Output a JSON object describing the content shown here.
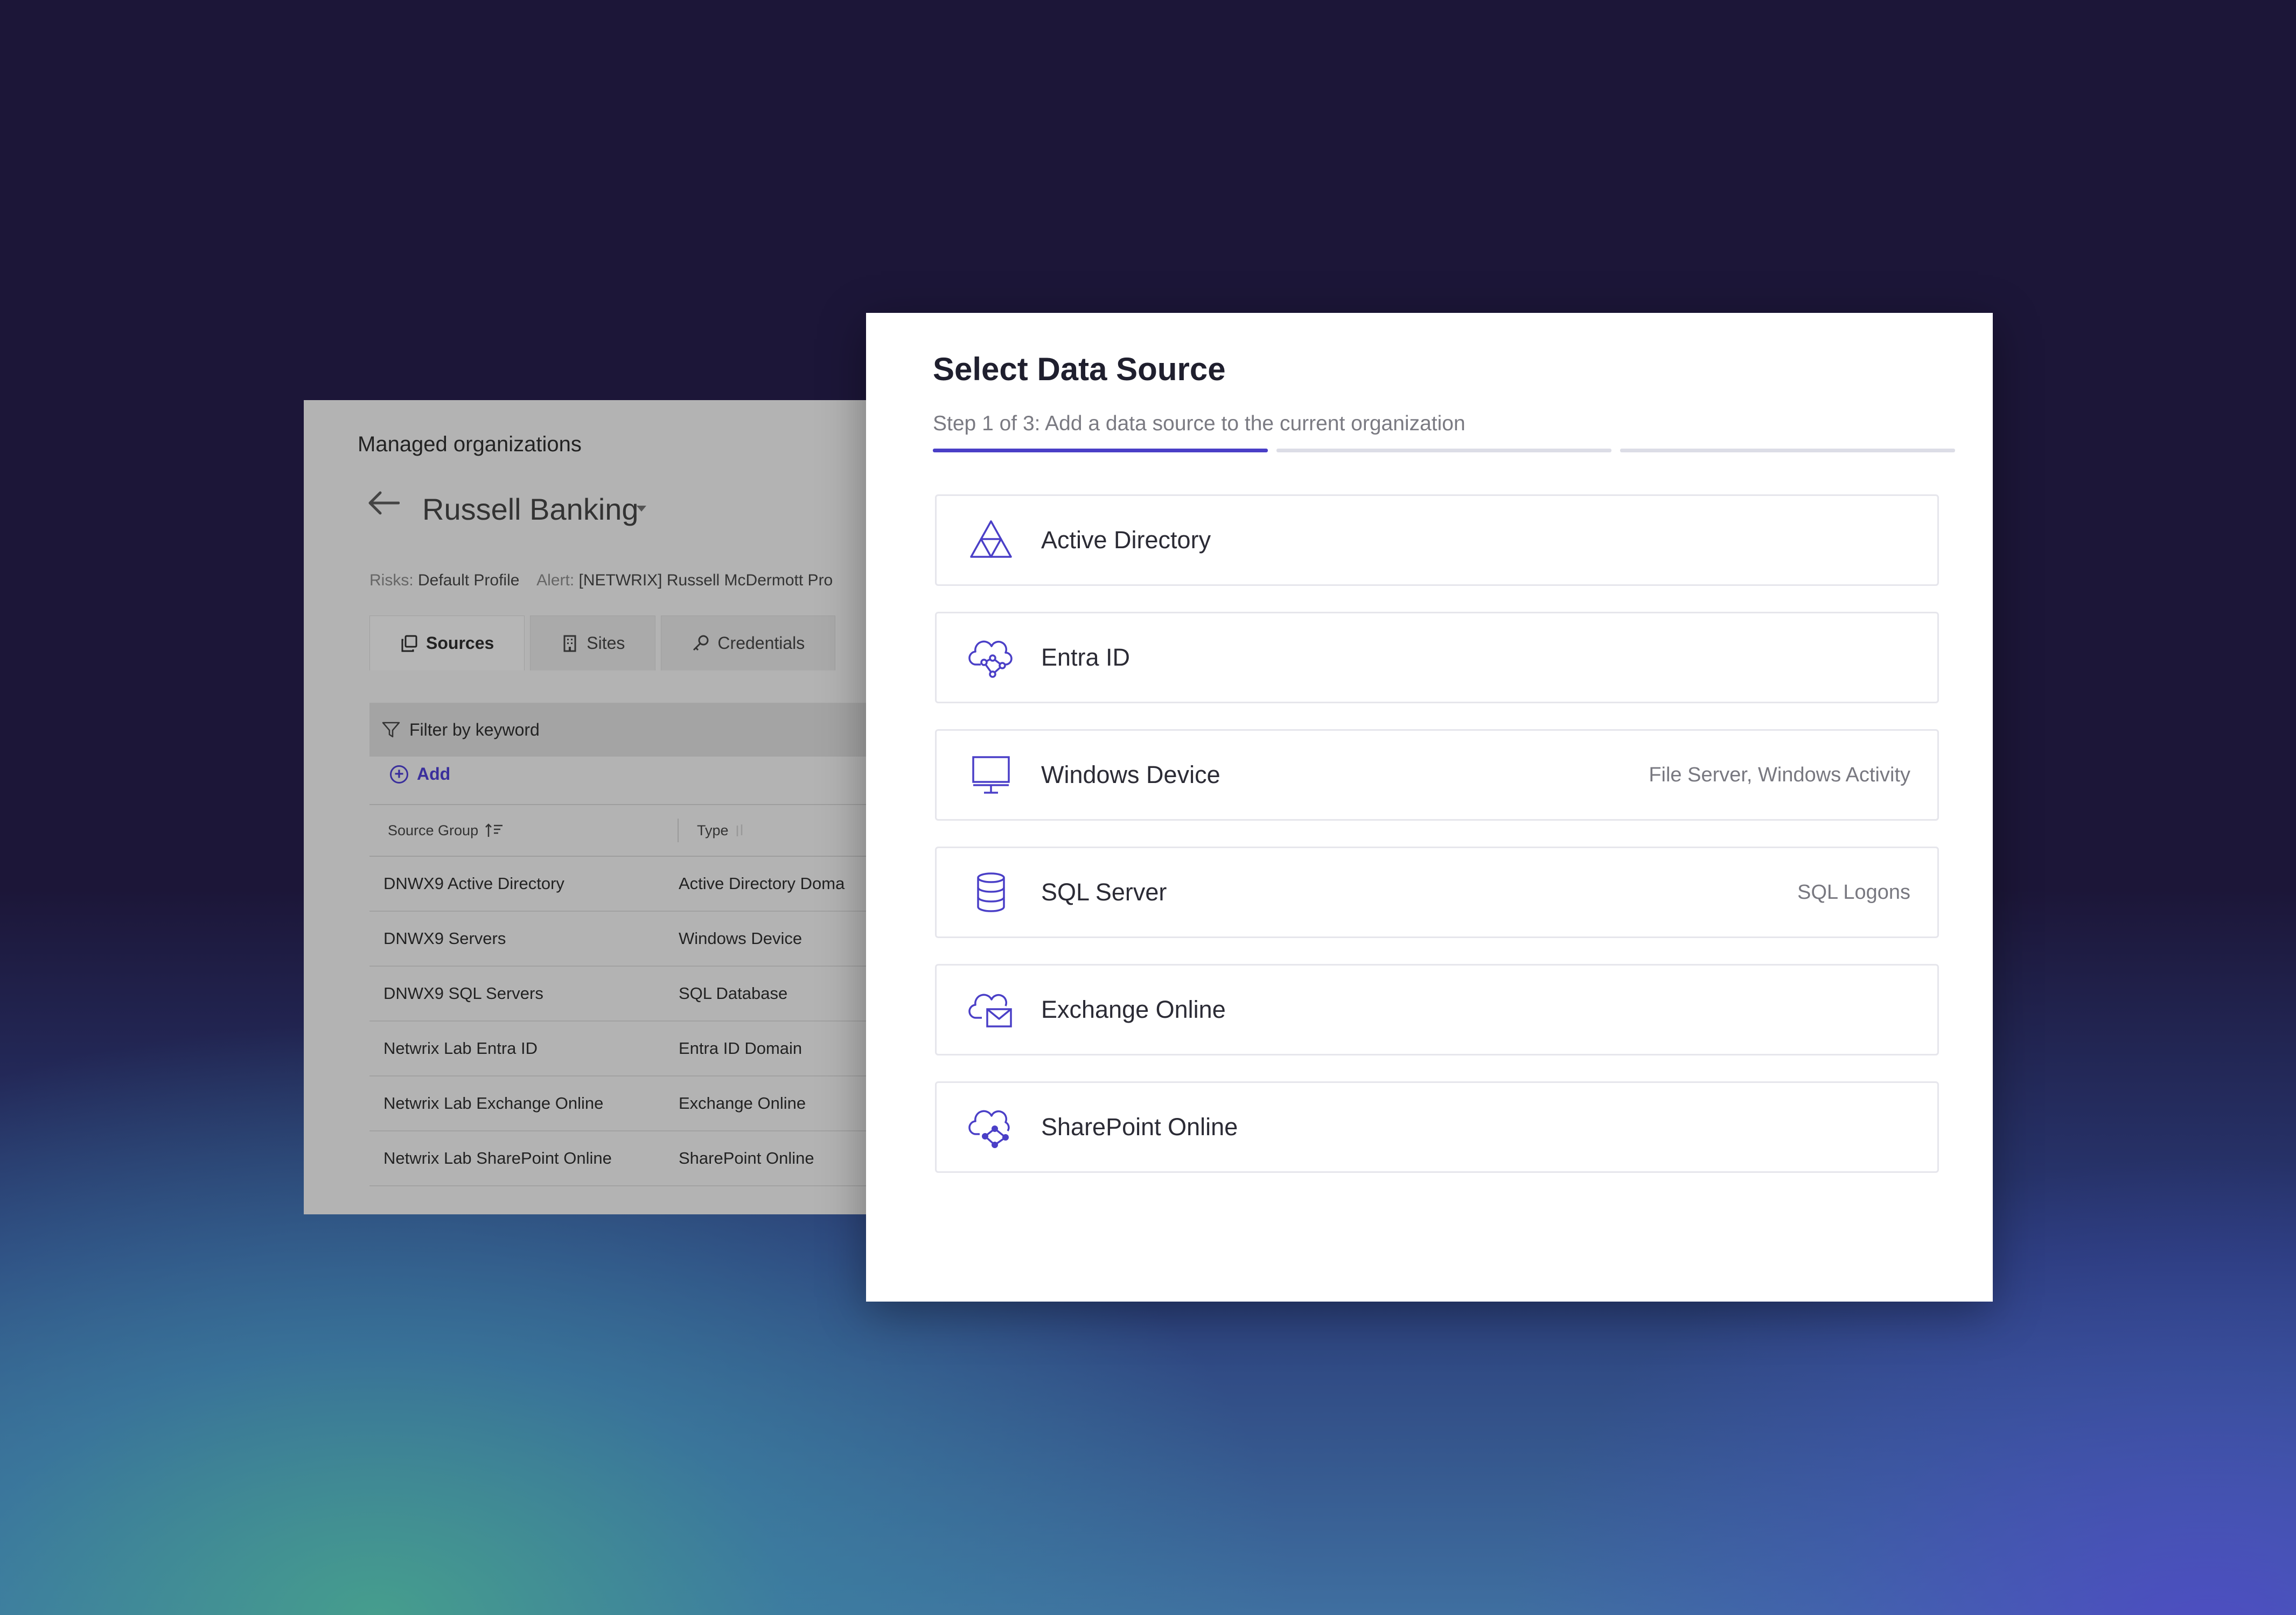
{
  "background_app": {
    "breadcrumb": "Managed organizations",
    "org_name": "Russell Banking",
    "meta": {
      "risks_key": "Risks:",
      "risks_value": "Default Profile",
      "alert_key": "Alert:",
      "alert_value": "[NETWRIX] Russell McDermott Pro"
    },
    "tabs": [
      {
        "label": "Sources",
        "icon": "copy-icon",
        "active": true
      },
      {
        "label": "Sites",
        "icon": "building-icon",
        "active": false
      },
      {
        "label": "Credentials",
        "icon": "key-icon",
        "active": false
      }
    ],
    "filter_placeholder": "Filter by keyword",
    "add_label": "Add",
    "table": {
      "columns": [
        "Source Group",
        "Type"
      ],
      "rows": [
        [
          "DNWX9 Active Directory",
          "Active Directory Doma"
        ],
        [
          "DNWX9 Servers",
          "Windows Device"
        ],
        [
          "DNWX9 SQL Servers",
          "SQL Database"
        ],
        [
          "Netwrix Lab Entra ID",
          "Entra ID Domain"
        ],
        [
          "Netwrix Lab Exchange Online",
          "Exchange Online"
        ],
        [
          "Netwrix Lab SharePoint Online",
          "SharePoint Online"
        ]
      ]
    }
  },
  "modal": {
    "title": "Select Data Source",
    "subtitle": "Step 1 of 3: Add a data source to the current organization",
    "progress": {
      "current_step": 1,
      "total_steps": 3
    },
    "accent_color": "#4a3fc7",
    "options": [
      {
        "label": "Active Directory",
        "hint": "",
        "icon": "triangle-nodes-icon"
      },
      {
        "label": "Entra ID",
        "hint": "",
        "icon": "cloud-network-icon"
      },
      {
        "label": "Windows Device",
        "hint": "File Server, Windows Activity",
        "icon": "monitor-icon"
      },
      {
        "label": "SQL Server",
        "hint": "SQL Logons",
        "icon": "database-icon"
      },
      {
        "label": "Exchange Online",
        "hint": "",
        "icon": "cloud-mail-icon"
      },
      {
        "label": "SharePoint Online",
        "hint": "",
        "icon": "cloud-share-icon"
      }
    ]
  }
}
